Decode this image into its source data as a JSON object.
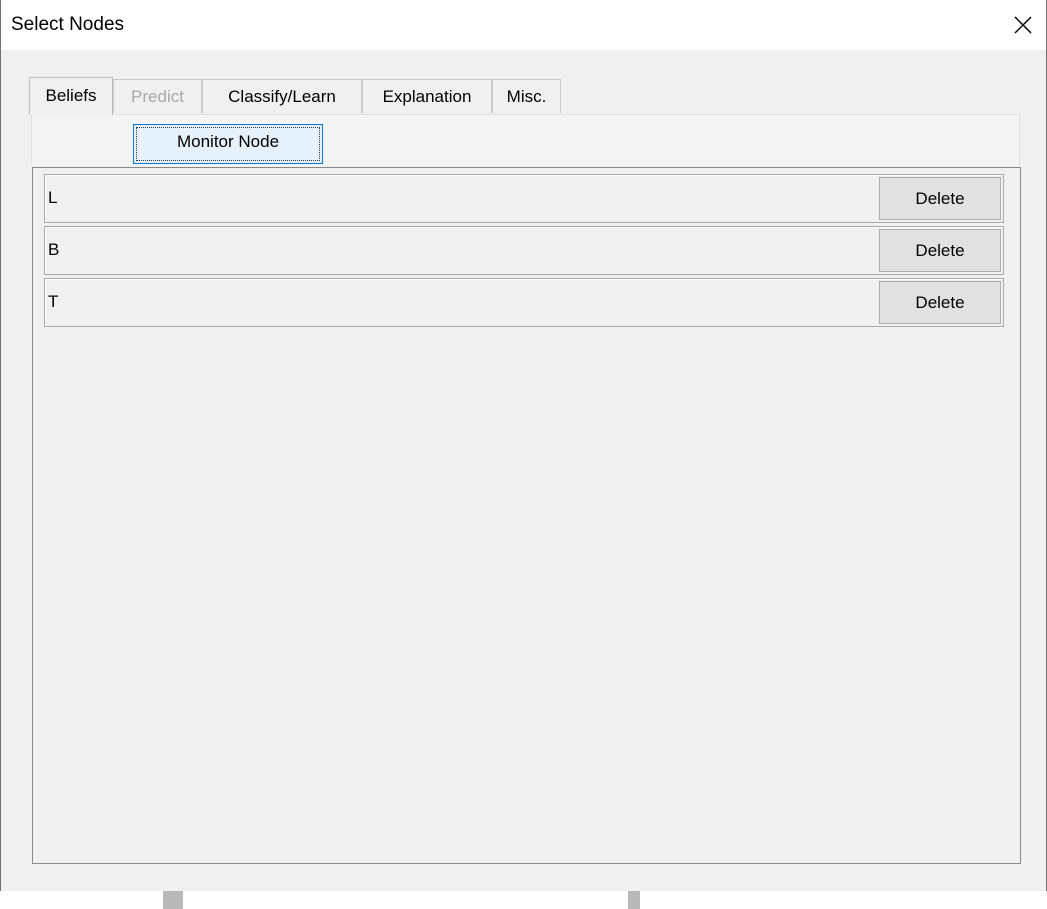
{
  "window": {
    "title": "Select Nodes",
    "close_icon": "close-icon"
  },
  "tabs": [
    {
      "label": "Beliefs",
      "state": "active"
    },
    {
      "label": "Predict",
      "state": "disabled"
    },
    {
      "label": "Classify/Learn",
      "state": "normal"
    },
    {
      "label": "Explanation",
      "state": "normal"
    },
    {
      "label": "Misc.",
      "state": "normal"
    }
  ],
  "toolbar": {
    "monitor_label": "Monitor Node"
  },
  "nodes": [
    {
      "name": "L",
      "delete_label": "Delete"
    },
    {
      "name": "B",
      "delete_label": "Delete"
    },
    {
      "name": "T",
      "delete_label": "Delete"
    }
  ],
  "colors": {
    "window_bg": "#f0f0f0",
    "focus_button_bg": "#e5f1fb",
    "focus_border": "#0078d7",
    "disabled_text": "#a8a8a8"
  }
}
